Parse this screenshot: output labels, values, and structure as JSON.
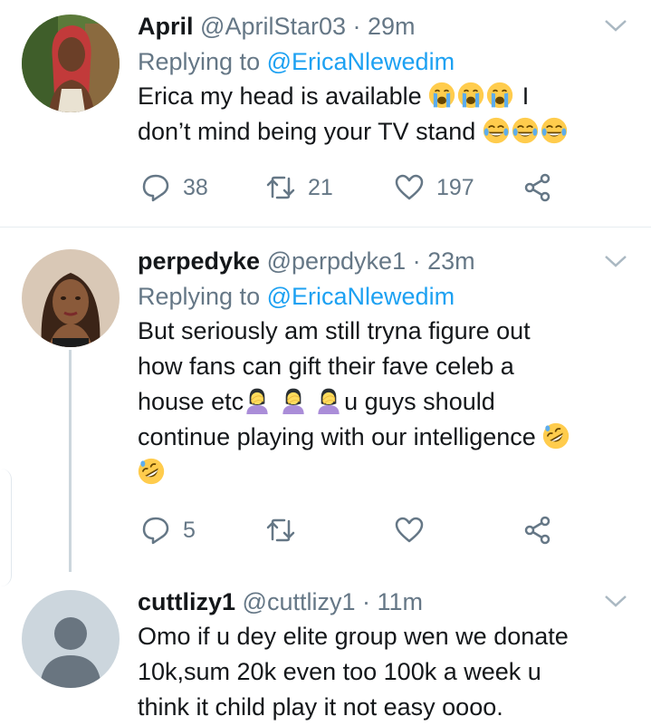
{
  "tweets": [
    {
      "name": "April",
      "handle": "@AprilStar03",
      "time": "· 29m",
      "replying_prefix": "Replying to",
      "replying_to": "@EricaNlewedim",
      "line1": "Erica my head is available",
      "line1_tail": "I",
      "line2": "don’t mind being your TV stand",
      "replies": "38",
      "retweets": "21",
      "likes": "197"
    },
    {
      "name": "perpedyke",
      "handle": "@perpdyke1",
      "time": "· 23m",
      "replying_prefix": "Replying to",
      "replying_to": "@EricaNlewedim",
      "line1": "But seriously am still tryna figure out",
      "line2": "how fans can gift their fave celeb a",
      "line3a": "house etc",
      "line3b": "u guys should",
      "line4": "continue playing with our intelligence",
      "replies": "5"
    },
    {
      "name": "cuttlizy1",
      "handle": "@cuttlizy1",
      "time": "· 11m",
      "line1": "Omo if u dey elite group wen we donate",
      "line2": "10k,sum 20k even too 100k a week u",
      "line3": "think it child play it not easy oooo."
    }
  ],
  "icons": {
    "reply": "reply-icon",
    "retweet": "retweet-icon",
    "like": "heart-icon",
    "share": "share-icon",
    "menu": "chevron-down-icon"
  },
  "colors": {
    "link": "#1da1f2",
    "secondary": "#657786",
    "divider": "#e6ecf0",
    "thread": "#ccd6dd",
    "emoji": "#ffcc4d"
  }
}
